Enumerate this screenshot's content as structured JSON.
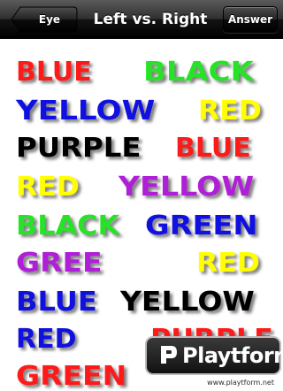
{
  "navbar": {
    "title": "Left vs. Right",
    "back_label": "Eye Tricks!",
    "answer_label": "Answer"
  },
  "words": [
    {
      "text": "BLUE",
      "color": "#ff1a1a"
    },
    {
      "text": "BLACK",
      "color": "#27e327"
    },
    {
      "text": "YELLOW",
      "color": "#1010e0"
    },
    {
      "text": "RED",
      "color": "#ffff00"
    },
    {
      "text": "PURPLE",
      "color": "#000000"
    },
    {
      "text": "BLUE",
      "color": "#ff1a1a"
    },
    {
      "text": "RED",
      "color": "#ffff00"
    },
    {
      "text": "YELLOW",
      "color": "#b01fd8"
    },
    {
      "text": "BLACK",
      "color": "#27e327"
    },
    {
      "text": "GREEN",
      "color": "#1010e0"
    },
    {
      "text": "GREE",
      "color": "#b01fd8"
    },
    {
      "text": "RED",
      "color": "#ffff00"
    },
    {
      "text": "BLUE",
      "color": "#1010e0"
    },
    {
      "text": "YELLOW",
      "color": "#000000"
    },
    {
      "text": "RED",
      "color": "#1010e0"
    },
    {
      "text": "PURPLE",
      "color": "#ff1a1a"
    },
    {
      "text": "GREEN",
      "color": "#ff1a1a"
    },
    {
      "text": "",
      "color": "#000000"
    }
  ],
  "watermark": {
    "brand": "Playtform",
    "url": "www.playtform.net",
    "colors": {
      "box": "#1a1a1a",
      "accent": "#ffffff"
    }
  }
}
